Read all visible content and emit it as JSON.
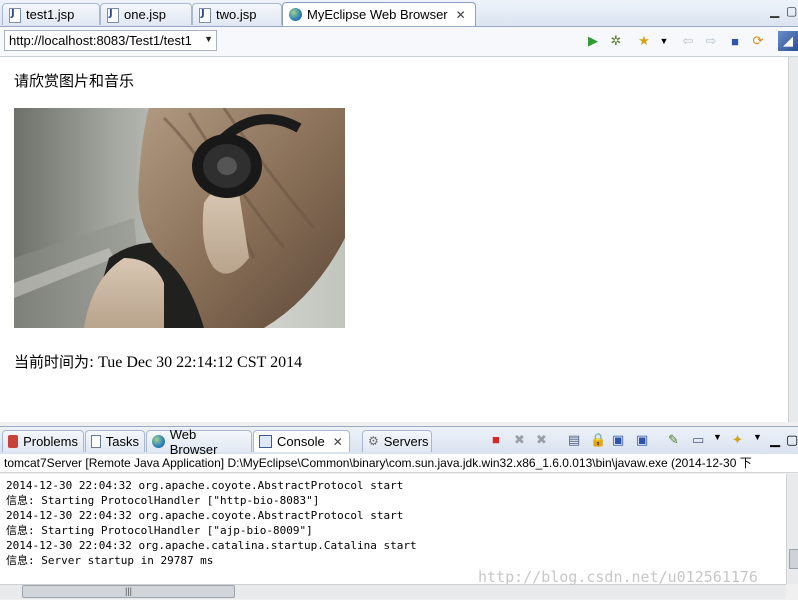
{
  "editor_tabs": [
    {
      "label": "test1.jsp",
      "icon": "jsp-file-icon"
    },
    {
      "label": "one.jsp",
      "icon": "jsp-file-icon"
    },
    {
      "label": "two.jsp",
      "icon": "jsp-file-icon"
    },
    {
      "label": "MyEclipse Web Browser",
      "icon": "globe-icon",
      "active": true
    }
  ],
  "browser": {
    "url": "http://localhost:8083/Test1/test1",
    "heading": "请欣赏图片和音乐",
    "time_label": "当前时间为:",
    "time_value": " Tue Dec 30 22:14:12 CST 2014"
  },
  "panel_tabs": [
    {
      "label": "Problems",
      "icon": "problems-icon"
    },
    {
      "label": "Tasks",
      "icon": "tasks-icon"
    },
    {
      "label": "Web Browser",
      "icon": "globe-icon"
    },
    {
      "label": "Console",
      "icon": "console-icon",
      "active": true
    },
    {
      "label": "Servers",
      "icon": "servers-icon"
    }
  ],
  "console": {
    "title": "tomcat7Server [Remote Java Application] D:\\MyEclipse\\Common\\binary\\com.sun.java.jdk.win32.x86_1.6.0.013\\bin\\javaw.exe (2014-12-30 下",
    "lines": [
      "2014-12-30 22:04:32 org.apache.coyote.AbstractProtocol start",
      "信息: Starting ProtocolHandler [\"http-bio-8083\"]",
      "2014-12-30 22:04:32 org.apache.coyote.AbstractProtocol start",
      "信息: Starting ProtocolHandler [\"ajp-bio-8009\"]",
      "2014-12-30 22:04:32 org.apache.catalina.startup.Catalina start",
      "信息: Server startup in 29787 ms"
    ]
  },
  "watermark": "http://blog.csdn.net/u012561176",
  "colors": {
    "accent": "#2b4b8c",
    "stop_red": "#d9262c",
    "run_green": "#2f9a33"
  }
}
